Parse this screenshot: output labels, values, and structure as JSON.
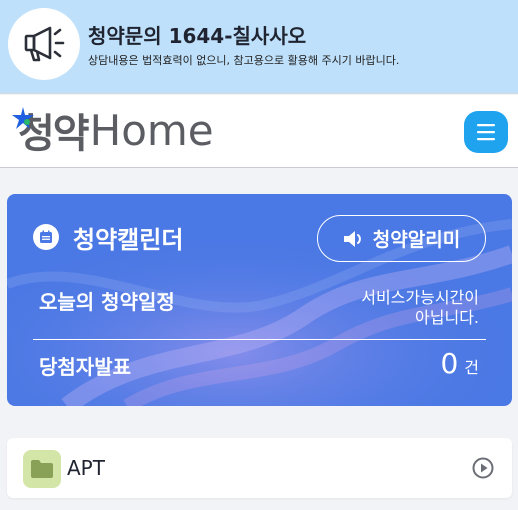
{
  "notice": {
    "title": "청약문의 1644-칠사사오",
    "subtitle": "상담내용은 법적효력이 없으니, 참고용으로 활용해 주시기 바랍니다.",
    "icon": "megaphone-icon"
  },
  "header": {
    "logo_korean": "청약",
    "logo_english": "Home",
    "menu_icon": "hamburger-menu-icon"
  },
  "calendar_card": {
    "title": "청약캘린더",
    "alarm_button_label": "청약알리미",
    "today_label": "오늘의 청약일정",
    "service_status_line1": "서비스가능시간이",
    "service_status_line2": "아닙니다.",
    "winner_label": "당첨자발표",
    "winner_count": "0",
    "winner_unit": "건"
  },
  "list": {
    "apt_label": "APT"
  },
  "colors": {
    "notice_bg": "#bfe0fb",
    "card_bg": "#4a78e4",
    "menu_button": "#1fa3ef",
    "folder_bg": "#d3e6a8",
    "logo_text": "#5b5d63"
  }
}
